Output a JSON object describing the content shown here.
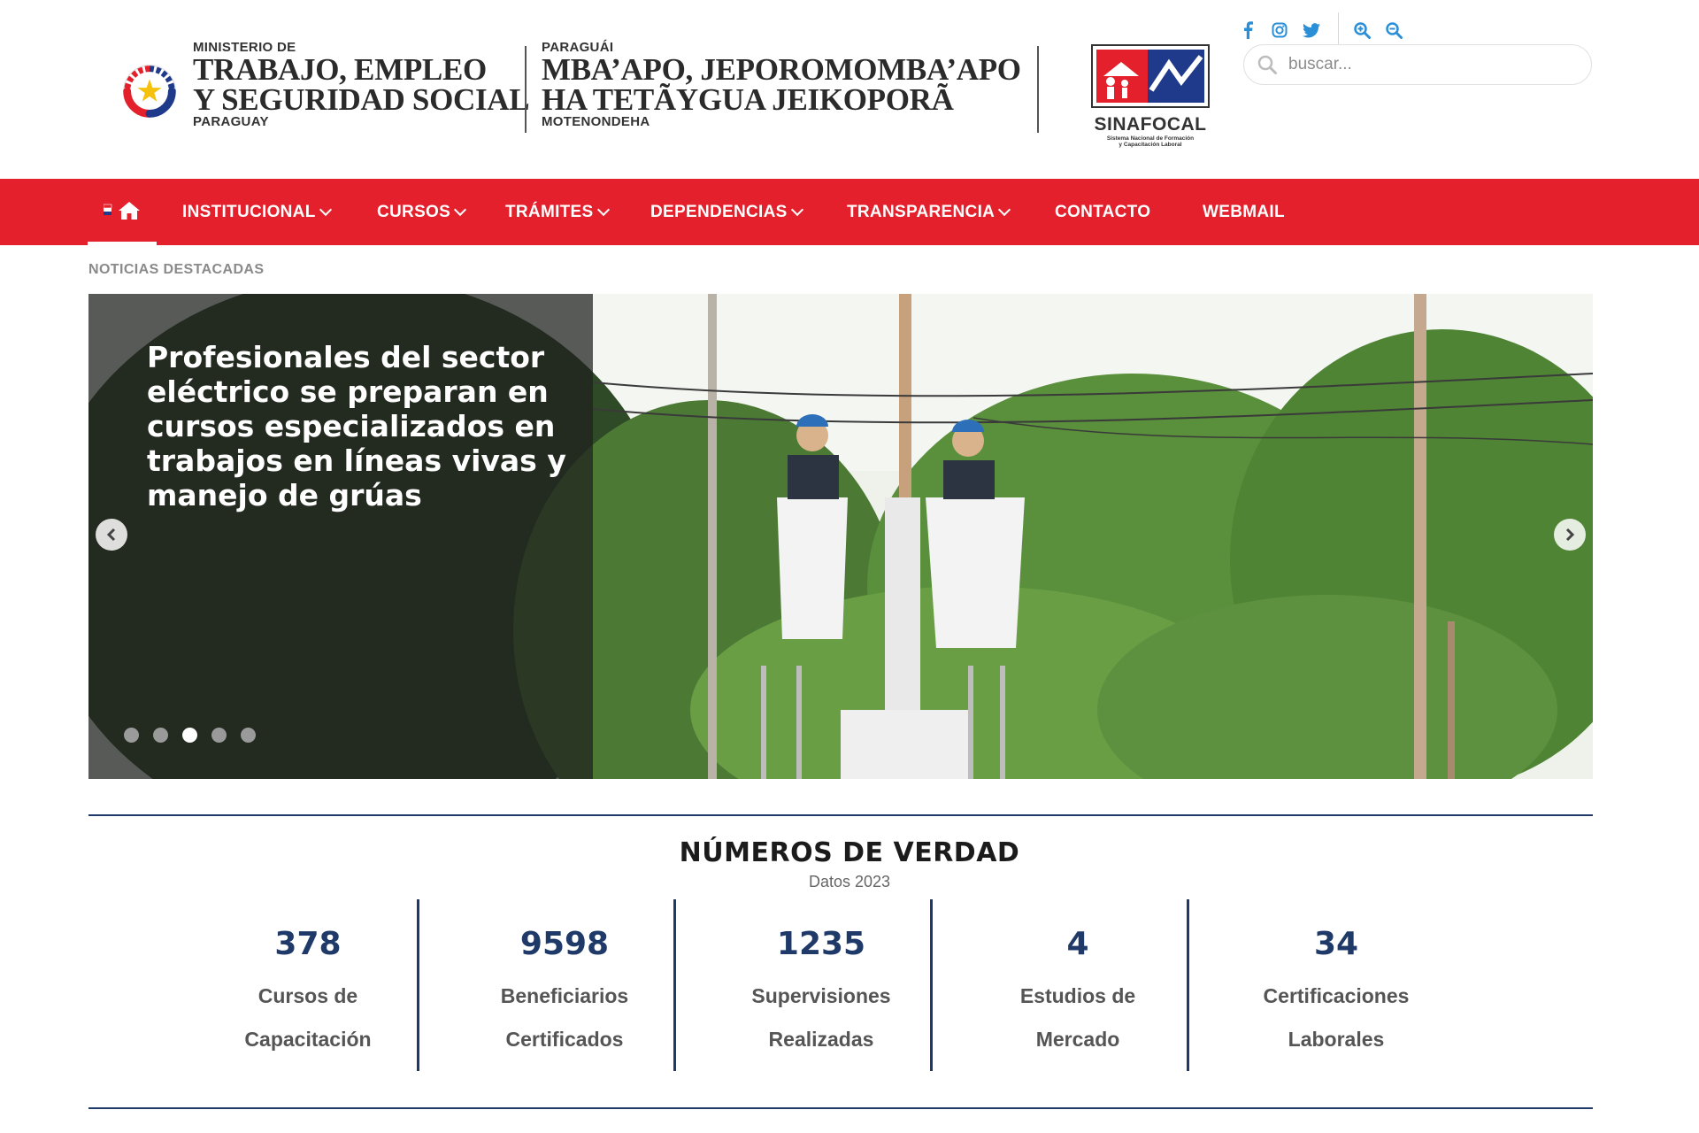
{
  "header": {
    "ministry": {
      "top_line": "MINISTERIO DE",
      "line1": "TRABAJO, EMPLEO",
      "line2": "Y SEGURIDAD SOCIAL",
      "bottom_line": "PARAGUAY"
    },
    "guarani": {
      "top_line": "PARAGUÁI",
      "line1": "MBA’APO, JEPOROMOMBA’APO",
      "line2": "HA TETÃYGUA JEIKOPORÃ",
      "bottom_line": "MOTENONDEHA"
    },
    "sinafocal": {
      "name": "SINAFOCAL",
      "subtitle_line1": "Sistema Nacional de Formación",
      "subtitle_line2": "y Capacitación Laboral"
    },
    "social_icons": [
      "facebook-icon",
      "instagram-icon",
      "twitter-icon"
    ],
    "zoom_icons": [
      "zoom-in-icon",
      "zoom-out-icon"
    ],
    "search": {
      "placeholder": "buscar..."
    }
  },
  "nav": {
    "home_icon": "home-icon",
    "items": [
      {
        "label": "INSTITUCIONAL",
        "dropdown": true
      },
      {
        "label": "CURSOS",
        "dropdown": true
      },
      {
        "label": "TRÁMITES",
        "dropdown": true
      },
      {
        "label": "DEPENDENCIAS",
        "dropdown": true
      },
      {
        "label": "TRANSPARENCIA",
        "dropdown": true
      },
      {
        "label": "CONTACTO",
        "dropdown": false
      },
      {
        "label": "WEBMAIL",
        "dropdown": false
      }
    ]
  },
  "featured": {
    "section_label": "NOTICIAS DESTACADAS",
    "slide_title": "Profesionales del sector eléctrico se preparan en cursos especializados en trabajos en líneas vivas y manejo de grúas",
    "slide_count": 5,
    "active_slide": 3
  },
  "stats": {
    "title": "NÚMEROS DE VERDAD",
    "subtitle": "Datos 2023",
    "items": [
      {
        "value": "378",
        "label_line1": "Cursos de",
        "label_line2": "Capacitación"
      },
      {
        "value": "9598",
        "label_line1": "Beneficiarios",
        "label_line2": "Certificados"
      },
      {
        "value": "1235",
        "label_line1": "Supervisiones",
        "label_line2": "Realizadas"
      },
      {
        "value": "4",
        "label_line1": "Estudios de",
        "label_line2": "Mercado"
      },
      {
        "value": "34",
        "label_line1": "Certificaciones",
        "label_line2": "Laborales"
      }
    ]
  },
  "colors": {
    "nav_red": "#e3202b",
    "navy": "#1f3a68",
    "social_blue": "#2a8fd6"
  }
}
